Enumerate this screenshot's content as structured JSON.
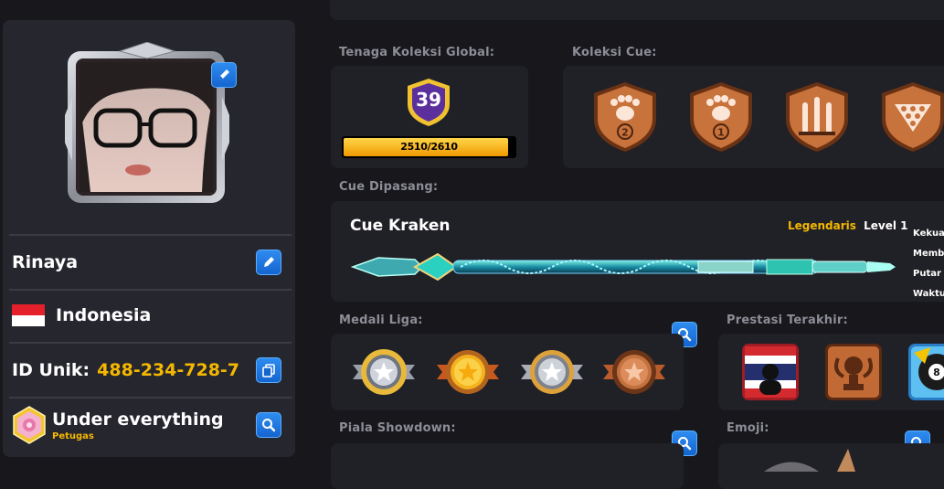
{
  "profile": {
    "name": "Rinaya",
    "country": "Indonesia",
    "id_label": "ID Unik:",
    "id_value": "488-234-728-7",
    "club_name": "Under everything",
    "club_role": "Petugas"
  },
  "collection_power": {
    "label": "Tenaga Koleksi Global:",
    "level": "39",
    "progress_text": "2510/2610",
    "progress_fraction": 0.962
  },
  "cue_collection": {
    "label": "Koleksi Cue:",
    "badges": [
      {
        "icon": "paw-icon",
        "number": "2"
      },
      {
        "icon": "paw-icon",
        "number": "1"
      },
      {
        "icon": "cue-rack-icon"
      },
      {
        "icon": "ball-rack-icon"
      }
    ]
  },
  "equipped_cue": {
    "label": "Cue Dipasang:",
    "name": "Cue Kraken",
    "rarity": "Legendaris",
    "level": "Level 1",
    "stats": [
      "Kekua",
      "Memb",
      "Putar",
      "Waktu"
    ]
  },
  "league_medals": {
    "label": "Medali Liga:",
    "medals": [
      {
        "tier": "silver-gold-rim"
      },
      {
        "tier": "gold"
      },
      {
        "tier": "silver"
      },
      {
        "tier": "bronze"
      }
    ]
  },
  "recent_achievements": {
    "label": "Prestasi Terakhir:",
    "items": [
      {
        "icon": "thailand-flag-icon"
      },
      {
        "icon": "trophy-icon"
      },
      {
        "icon": "eight-ball-icon"
      }
    ]
  },
  "showdown_trophy": {
    "label": "Piala Showdown:"
  },
  "emoji": {
    "label": "Emoji:"
  },
  "colors": {
    "accent_gold": "#f5b800",
    "button_blue": "#1f78e0",
    "legendary": "#f5b800"
  }
}
